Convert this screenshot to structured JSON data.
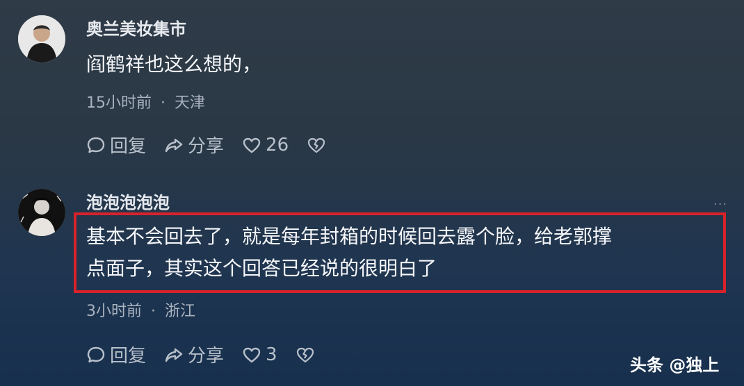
{
  "comments": [
    {
      "username": "奥兰美妆集市",
      "content": "阎鹤祥也这么想的，",
      "time": "15小时前",
      "location": "天津",
      "reply_label": "回复",
      "share_label": "分享",
      "likes": "26"
    },
    {
      "username": "泡泡泡泡泡",
      "content_line1": "基本不会回去了，就是每年封箱的时候回去露个脸，给老郭撑",
      "content_line2": "点面子，其实这个回答已经说的很明白了",
      "time": "3小时前",
      "location": "浙江",
      "reply_label": "回复",
      "share_label": "分享",
      "likes": "3"
    }
  ],
  "separator": "·",
  "more_label": "···",
  "watermark": "头条 @独上",
  "colors": {
    "highlight_border": "#d8222a",
    "meta_text": "#aab3bf"
  }
}
